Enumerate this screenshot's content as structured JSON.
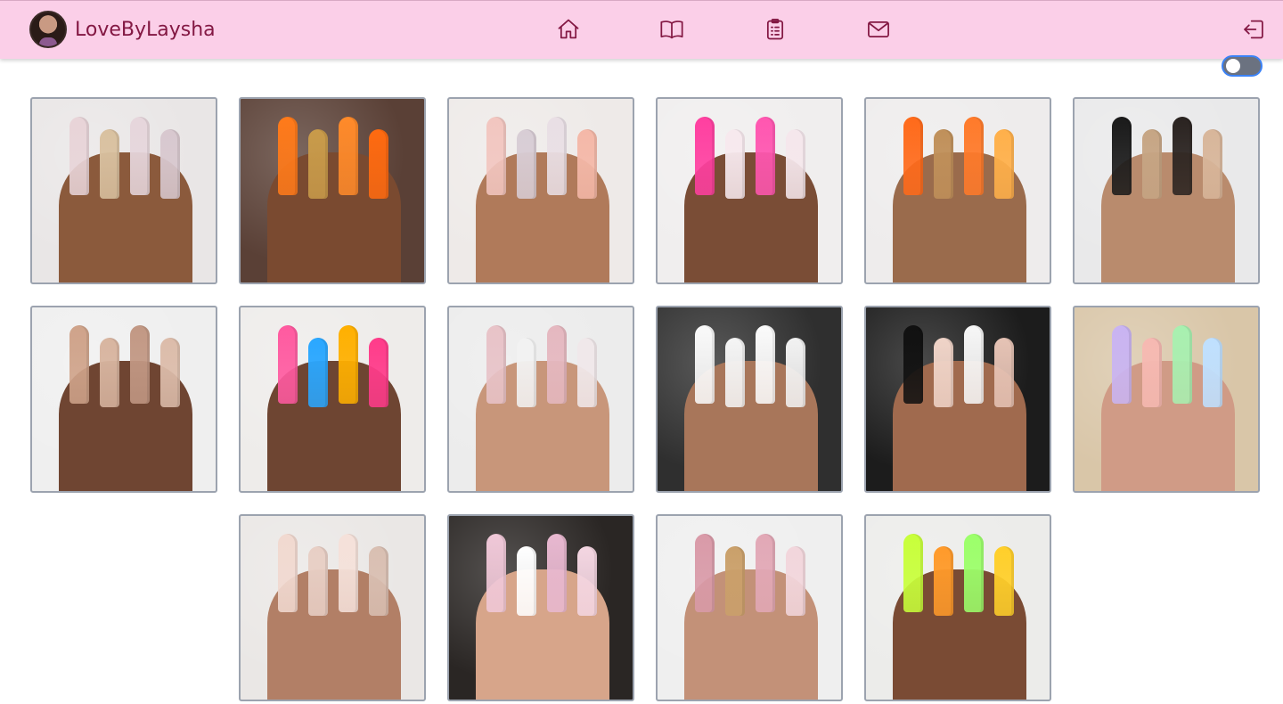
{
  "brand": {
    "name": "LoveByLaysha",
    "avatar_icon": "profile-avatar"
  },
  "nav": {
    "items": [
      {
        "name": "home",
        "icon": "home-icon"
      },
      {
        "name": "book",
        "icon": "book-icon"
      },
      {
        "name": "clipboard",
        "icon": "clipboard-icon"
      },
      {
        "name": "mail",
        "icon": "mail-icon"
      }
    ],
    "logout_icon": "logout-icon"
  },
  "theme_toggle": {
    "state": "off"
  },
  "colors": {
    "navbar": "#fbcfe8",
    "brand_text": "#831843",
    "tile_border": "#9ca3af",
    "toggle_border": "#3b82f6"
  },
  "gallery": [
    {
      "bg": "#e9e6e6",
      "skin": "#8b5a3c",
      "nail": [
        "#e8d4d8",
        "#d9c1a0",
        "#e6d6dc",
        "#d8c8cf"
      ]
    },
    {
      "bg": "#5a4036",
      "skin": "#7a4a30",
      "nail": [
        "#ff7a1a",
        "#c99b4a",
        "#ff8a2a",
        "#ff6a10"
      ]
    },
    {
      "bg": "#eeeae8",
      "skin": "#b07a5a",
      "nail": [
        "#f2c6c0",
        "#d8cdd5",
        "#e9dfe5",
        "#f4b8a8"
      ]
    },
    {
      "bg": "#f0eeee",
      "skin": "#7a4d36",
      "nail": [
        "#ff3fa0",
        "#f7e9ee",
        "#ff56b0",
        "#f5e7ec"
      ]
    },
    {
      "bg": "#eeecec",
      "skin": "#9a6b4c",
      "nail": [
        "#ff6a1a",
        "#c0905a",
        "#ff7a2a",
        "#ffb04a"
      ]
    },
    {
      "bg": "#e9e9ea",
      "skin": "#b98b6d",
      "nail": [
        "#1a1a1a",
        "#c6a584",
        "#2a2320",
        "#d8b69a"
      ]
    },
    {
      "bg": "#efefef",
      "skin": "#6f4532",
      "nail": [
        "#cfa38a",
        "#d8b5a0",
        "#c29884",
        "#dcbcaa"
      ]
    },
    {
      "bg": "#eeecea",
      "skin": "#6e4532",
      "nail": [
        "#ff5aa0",
        "#2aa7ff",
        "#ffb000",
        "#ff3b8a"
      ]
    },
    {
      "bg": "#ececec",
      "skin": "#c8967a",
      "nail": [
        "#e8c3c8",
        "#f2f2f2",
        "#e5b8c0",
        "#f0e8ea"
      ]
    },
    {
      "bg": "#2f2f2f",
      "skin": "#a8765a",
      "nail": [
        "#fafafa",
        "#f5f5f5",
        "#fbfbfb",
        "#f2f2f2"
      ]
    },
    {
      "bg": "#1c1c1c",
      "skin": "#a06a4e",
      "nail": [
        "#111111",
        "#f0d4c8",
        "#f7f7f7",
        "#e6c3b5"
      ]
    },
    {
      "bg": "#d9c6a8",
      "skin": "#d09b86",
      "nail": [
        "#c9b4f2",
        "#f6b9b2",
        "#a8f0b0",
        "#bfe0ff"
      ]
    },
    {
      "bg": "#eae7e5",
      "skin": "#b27f66",
      "nail": [
        "#f1d9d0",
        "#e8cfc5",
        "#f5e1da",
        "#d9bfb2"
      ]
    },
    {
      "bg": "#2a2624",
      "skin": "#d7a58a",
      "nail": [
        "#f0c8d8",
        "#ffffff",
        "#e8b8d0",
        "#f4d6e2"
      ]
    },
    {
      "bg": "#efefef",
      "skin": "#c39178",
      "nail": [
        "#d99aa8",
        "#caa06a",
        "#e2a8b6",
        "#f2d6dc"
      ]
    },
    {
      "bg": "#ececea",
      "skin": "#7a4b34",
      "nail": [
        "#c8ff3a",
        "#ff9a2a",
        "#9cff6a",
        "#ffcf2a"
      ]
    }
  ]
}
